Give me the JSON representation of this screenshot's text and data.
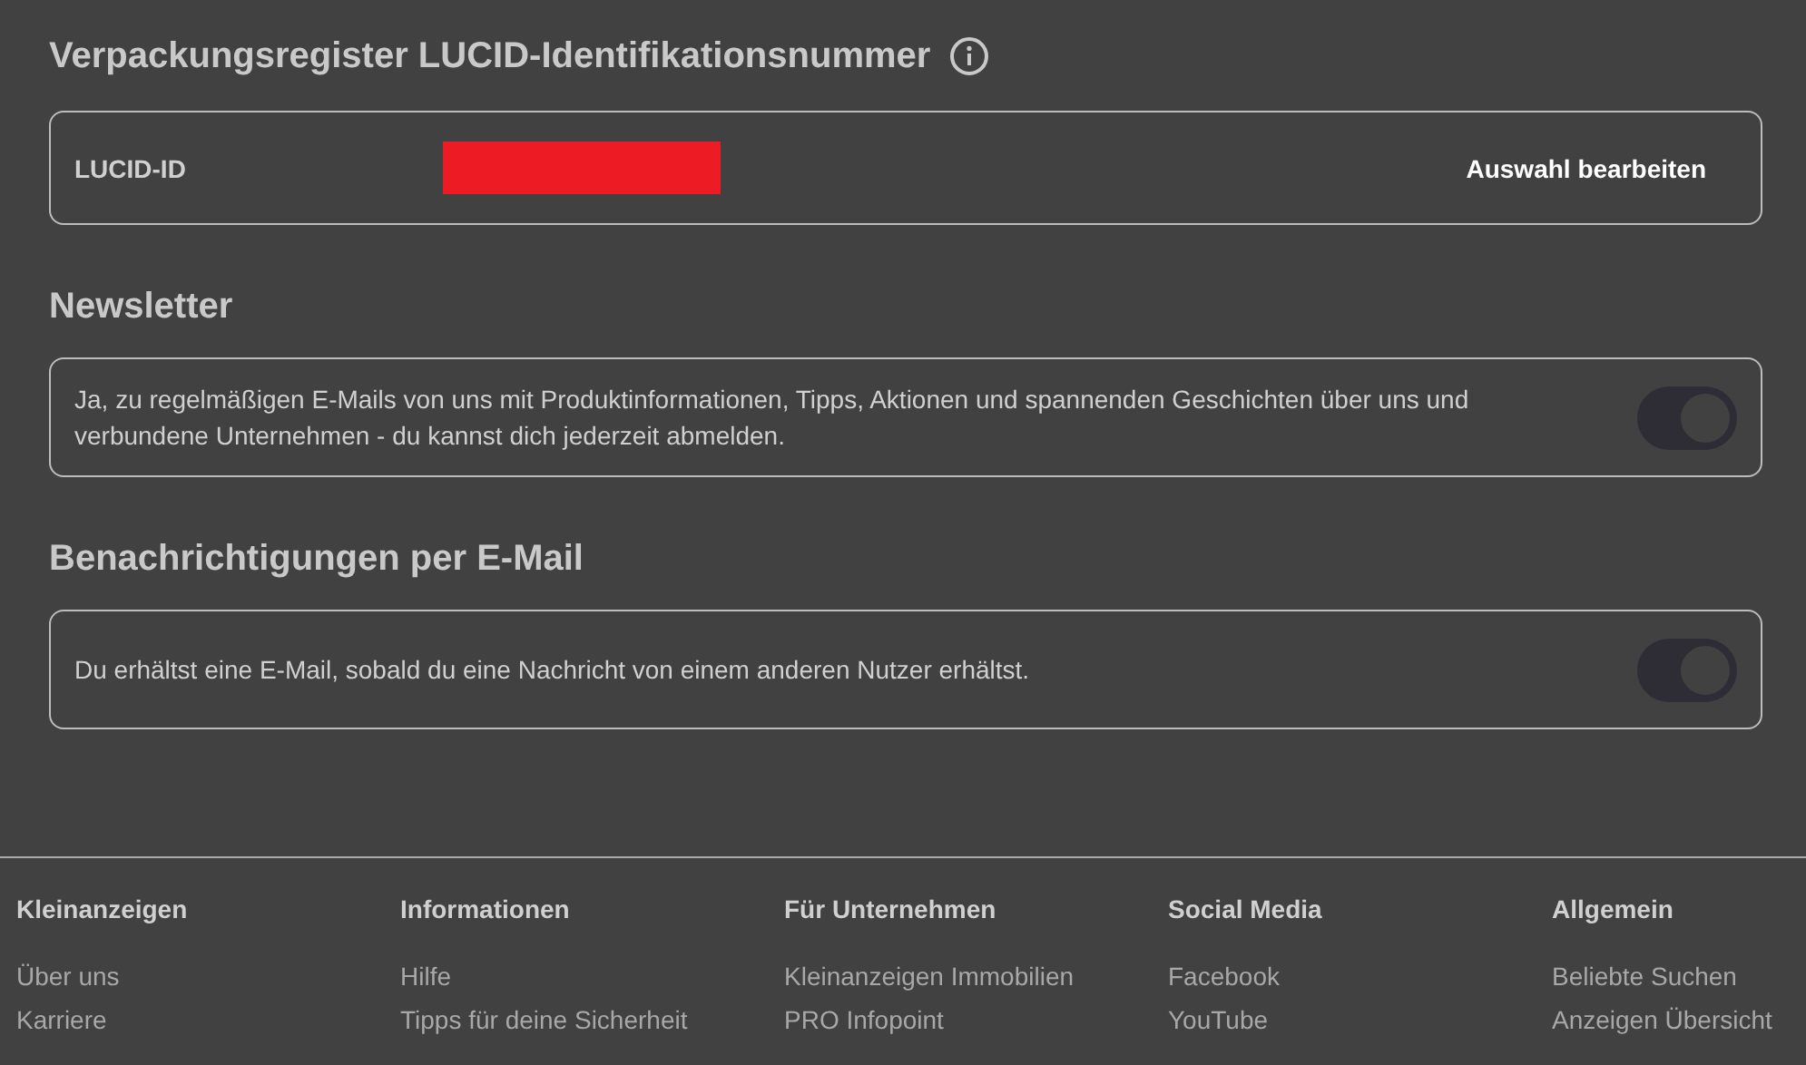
{
  "lucid": {
    "heading": "Verpackungsregister LUCID-Identifikationsnummer",
    "label": "LUCID-ID",
    "redacted": true,
    "action": "Auswahl bearbeiten"
  },
  "sections": [
    {
      "heading": "Newsletter",
      "text": "Ja, zu regelmäßigen E-Mails von uns mit Produktinformationen, Tipps, Aktionen und spannenden Geschichten über uns und verbundene Unternehmen - du kannst dich jederzeit abmelden.",
      "on": true
    },
    {
      "heading": "Benachrichtigungen per E-Mail",
      "text": "Du erhältst eine E-Mail, sobald du eine Nachricht von einem anderen Nutzer erhältst.",
      "on": true
    }
  ],
  "footer": [
    {
      "heading": "Kleinanzeigen",
      "links": [
        "Über uns",
        "Karriere"
      ]
    },
    {
      "heading": "Informationen",
      "links": [
        "Hilfe",
        "Tipps für deine Sicherheit"
      ]
    },
    {
      "heading": "Für Unternehmen",
      "links": [
        "Kleinanzeigen Immobilien",
        "PRO Infopoint"
      ]
    },
    {
      "heading": "Social Media",
      "links": [
        "Facebook",
        "YouTube"
      ]
    },
    {
      "heading": "Allgemein",
      "links": [
        "Beliebte Suchen",
        "Anzeigen Übersicht"
      ]
    }
  ]
}
